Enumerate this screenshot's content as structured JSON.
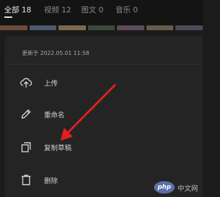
{
  "tabs": [
    {
      "label": "全部 18",
      "active": true
    },
    {
      "label": "视频 12",
      "active": false
    },
    {
      "label": "图文 0",
      "active": false
    },
    {
      "label": "音乐 0",
      "active": false
    }
  ],
  "file_meta": "更新于 2022.05.01 11:58",
  "menu": [
    {
      "icon": "cloud-upload-icon",
      "label": "上传"
    },
    {
      "icon": "pencil-icon",
      "label": "重命名"
    },
    {
      "icon": "copy-icon",
      "label": "复制草稿"
    },
    {
      "icon": "trash-icon",
      "label": "删除"
    }
  ],
  "watermark": {
    "logo": "php",
    "text": "中文网"
  },
  "colors": {
    "arrow": "#e02020",
    "sheet": "#242424",
    "background": "#1b1b1b"
  }
}
